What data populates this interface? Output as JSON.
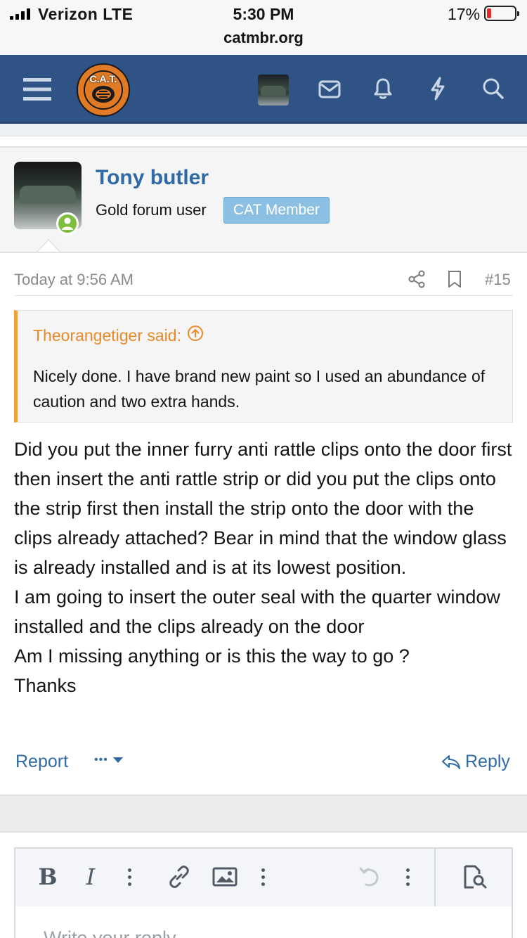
{
  "status_bar": {
    "carrier": "Verizon  LTE",
    "time": "5:30 PM",
    "url": "catmbr.org",
    "battery": "17%",
    "battery_level": 0.17
  },
  "nav": {
    "logo_text": "C.A.T.",
    "icons": [
      "menu-icon",
      "mail-icon",
      "bell-icon",
      "bolt-icon",
      "search-icon"
    ]
  },
  "post": {
    "username": "Tony butler",
    "user_title": "Gold forum user",
    "user_banner": "CAT Member",
    "date": "Today at 9:56 AM",
    "number": "#15",
    "quote": {
      "attribution": "Theorangetiger said:",
      "text": "Nicely done. I have brand new paint so I used an abundance of caution and two extra hands."
    },
    "message": "Did you put the inner furry anti rattle clips onto the door first then insert the anti rattle strip or did you put the clips onto the strip first then install the strip onto the door with the clips already attached? Bear in mind that the window glass is already installed and is at its lowest position.\nI am going to insert the outer seal with the quarter window installed and the clips already on the door\nAm I missing anything or is this the way to go ?\nThanks",
    "actions": {
      "report": "Report",
      "more": "•••",
      "reply": "Reply"
    }
  },
  "editor": {
    "bold": "B",
    "italic": "I",
    "placeholder": "Write your reply..."
  },
  "colors": {
    "nav_bg": "#2e5384",
    "link": "#2f6aa6",
    "quote_accent": "#f0a13a",
    "banner": "#8cc0e2",
    "online": "#7fbf3f"
  }
}
